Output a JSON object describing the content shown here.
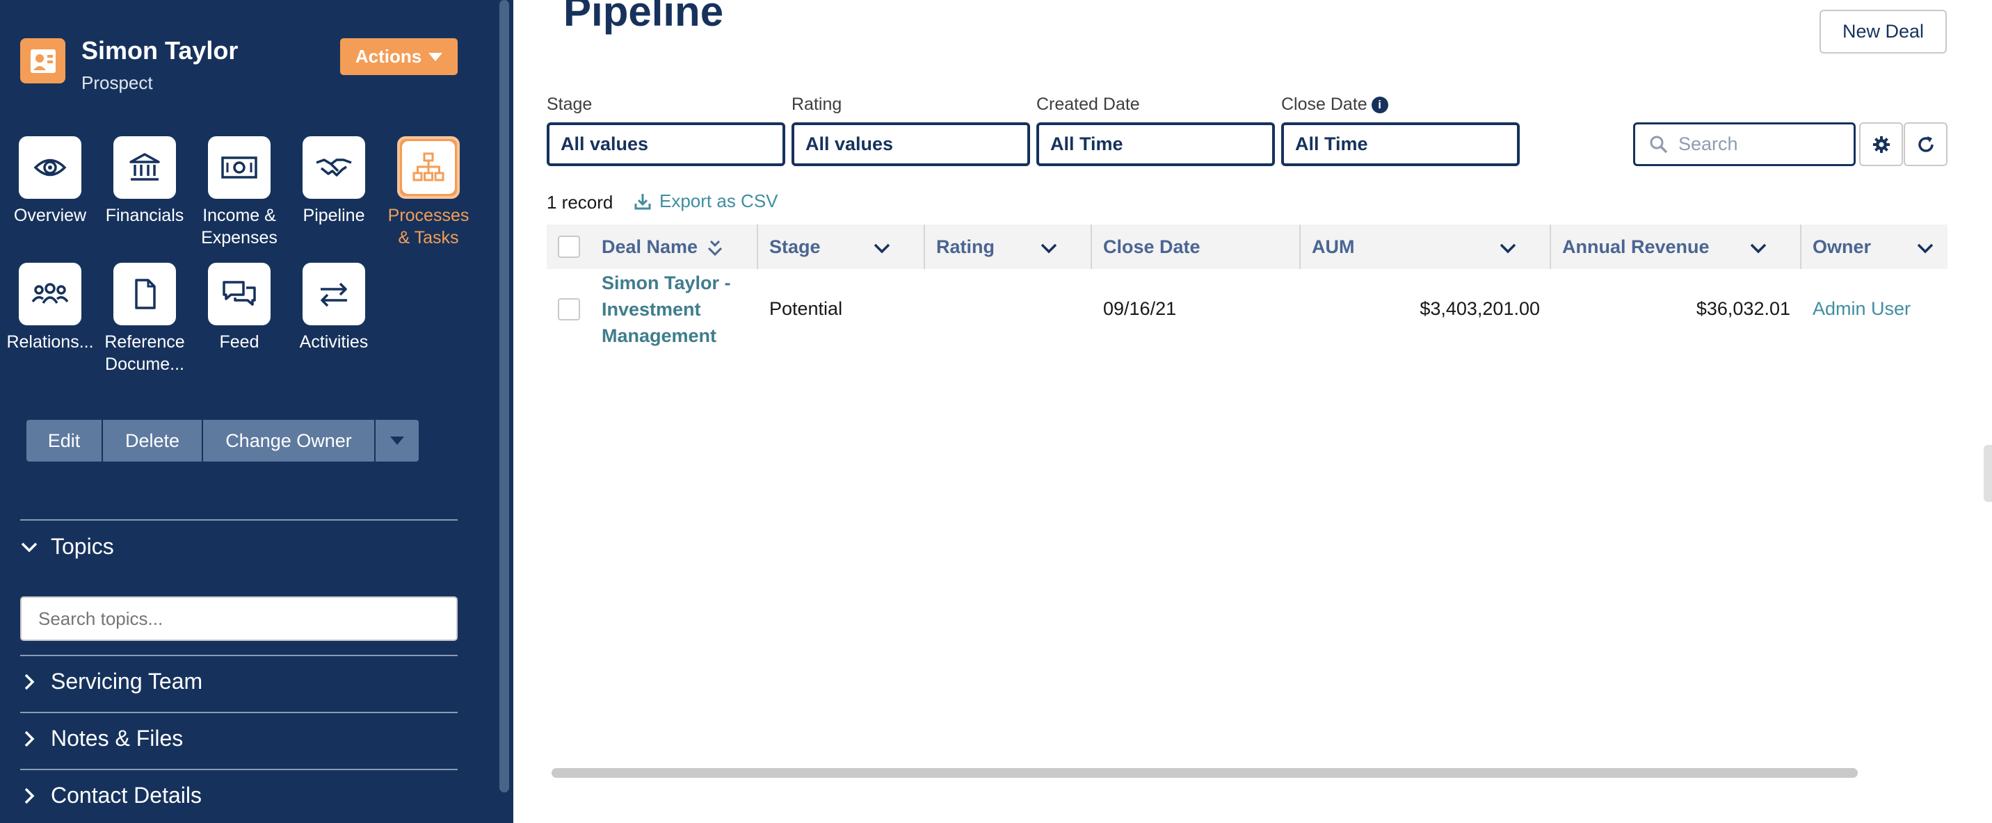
{
  "sidebar": {
    "profile": {
      "name": "Simon Taylor",
      "subtitle": "Prospect"
    },
    "actions_label": "Actions",
    "tiles": [
      {
        "label": "Overview",
        "icon": "eye-icon"
      },
      {
        "label": "Financials",
        "icon": "bank-icon"
      },
      {
        "label": "Income & Expenses",
        "icon": "money-icon"
      },
      {
        "label": "Pipeline",
        "icon": "handshake-icon"
      },
      {
        "label": "Processes & Tasks",
        "icon": "hierarchy-icon",
        "active": true
      },
      {
        "label": "Relations...",
        "icon": "people-icon"
      },
      {
        "label": "Reference Docume...",
        "icon": "document-icon"
      },
      {
        "label": "Feed",
        "icon": "chat-icon"
      },
      {
        "label": "Activities",
        "icon": "swap-icon"
      }
    ],
    "buttons": {
      "edit": "Edit",
      "delete": "Delete",
      "change_owner": "Change Owner"
    },
    "topics": {
      "label": "Topics",
      "placeholder": "Search topics..."
    },
    "sections": [
      "Servicing Team",
      "Notes & Files",
      "Contact Details"
    ]
  },
  "main": {
    "title": "Pipeline",
    "new_deal": "New Deal",
    "filters": [
      {
        "label": "Stage",
        "value": "All values"
      },
      {
        "label": "Rating",
        "value": "All values"
      },
      {
        "label": "Created Date",
        "value": "All Time"
      },
      {
        "label": "Close Date",
        "value": "All Time",
        "info": "i"
      }
    ],
    "search_placeholder": "Search",
    "record_count": "1 record",
    "export_label": "Export as CSV",
    "table": {
      "columns": [
        "Deal Name",
        "Stage",
        "Rating",
        "Close Date",
        "AUM",
        "Annual Revenue",
        "Owner"
      ],
      "rows": [
        {
          "deal_name": "Simon Taylor - Investment Management",
          "deal_name_lines": [
            "Simon Taylor -",
            "Investment",
            "Management"
          ],
          "stage": "Potential",
          "rating": "",
          "close_date": "09/16/21",
          "aum": "$3,403,201.00",
          "annual_revenue": "$36,032.01",
          "owner": "Admin User"
        }
      ]
    }
  },
  "colors": {
    "sidebar_bg": "#16325c",
    "accent_orange": "#f49d56",
    "link_teal": "#3f8ea0",
    "header_text": "#4a6592"
  }
}
